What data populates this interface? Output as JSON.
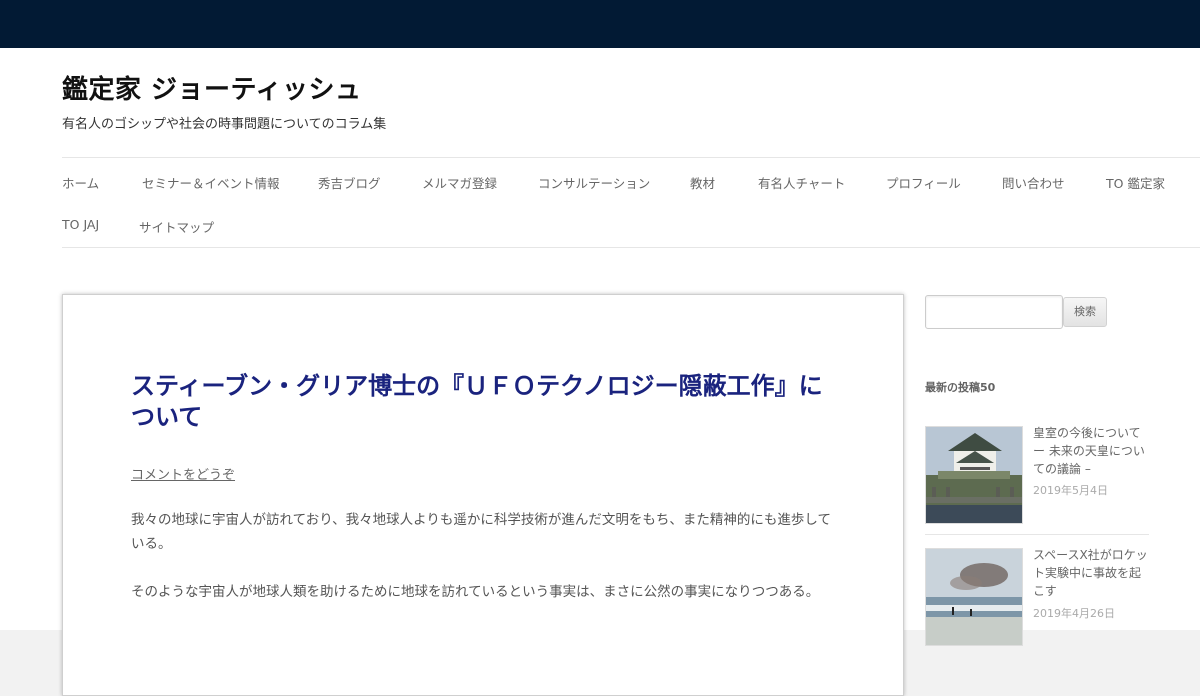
{
  "site": {
    "title": "鑑定家 ジョーティッシュ",
    "description": "有名人のゴシップや社会の時事問題についてのコラム集"
  },
  "nav": {
    "items": [
      "ホーム",
      "セミナー＆イベント情報",
      "秀吉ブログ",
      "メルマガ登録",
      "コンサルテーション",
      "教材",
      "有名人チャート",
      "プロフィール",
      "問い合わせ",
      "TO 鑑定家",
      "TO JAJ",
      "サイトマップ"
    ]
  },
  "article": {
    "title": "スティーブン・グリア博士の『ＵＦＯテクノロジー隠蔽工作』について",
    "comment_link": "コメントをどうぞ",
    "paragraphs": [
      "我々の地球に宇宙人が訪れており、我々地球人よりも遥かに科学技術が進んだ文明をもち、また精神的にも進歩している。",
      "そのような宇宙人が地球人類を助けるために地球を訪れているという事実は、まさに公然の事実になりつつある。"
    ]
  },
  "sidebar": {
    "search": {
      "value": "",
      "button_label": "検索"
    },
    "recent_posts_title": "最新の投稿50",
    "recent_posts": [
      {
        "title": "皇室の今後について ー 未来の天皇についての議論 –",
        "date": "2019年5月4日"
      },
      {
        "title": "スペースX社がロケット実験中に事故を起こす",
        "date": "2019年4月26日"
      }
    ]
  },
  "colors": {
    "topbar": "#021a34",
    "title_link": "#1a237e"
  }
}
